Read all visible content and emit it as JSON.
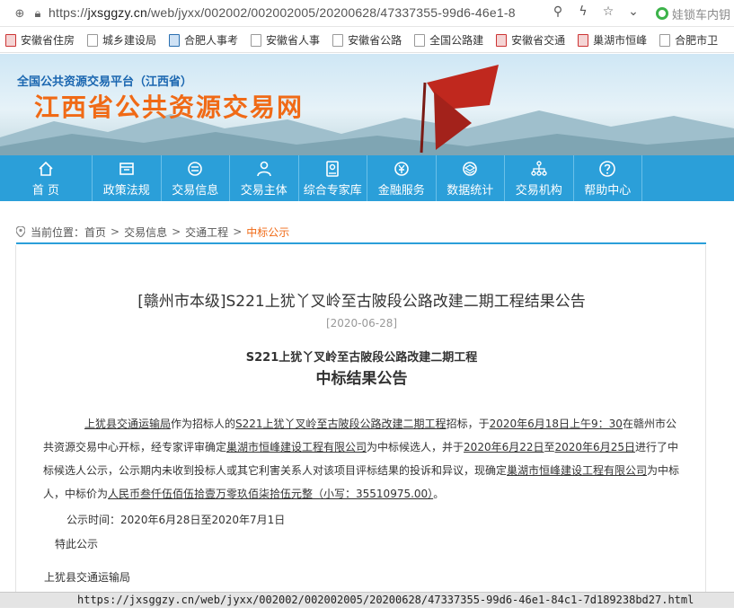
{
  "browser": {
    "url_prefix": "https://",
    "url_host": "jxsggzy.cn",
    "url_path": "/web/jyxx/002002/002002005/20200628/47337355-99d6-46e1-8",
    "search_text": "娃锁车内钥",
    "bookmarks": [
      {
        "label": "安徽省住房",
        "icon": "red-doc-icon"
      },
      {
        "label": "城乡建设局",
        "icon": "doc-icon"
      },
      {
        "label": "合肥人事考",
        "icon": "blue-doc-icon"
      },
      {
        "label": "安徽省人事",
        "icon": "doc-icon"
      },
      {
        "label": "安徽省公路",
        "icon": "doc-icon"
      },
      {
        "label": "全国公路建",
        "icon": "doc-icon"
      },
      {
        "label": "安徽省交通",
        "icon": "red-doc-icon"
      },
      {
        "label": "巢湖市恒峰",
        "icon": "red-doc-icon"
      },
      {
        "label": "合肥市卫",
        "icon": "doc-icon"
      }
    ]
  },
  "site": {
    "subtitle": "全国公共资源交易平台（江西省）",
    "title": "江西省公共资源交易网"
  },
  "nav": [
    {
      "label": "首 页",
      "icon": "home-icon"
    },
    {
      "label": "政策法规",
      "icon": "folder-icon"
    },
    {
      "label": "交易信息",
      "icon": "list-icon"
    },
    {
      "label": "交易主体",
      "icon": "user-icon"
    },
    {
      "label": "综合专家库",
      "icon": "badge-icon"
    },
    {
      "label": "金融服务",
      "icon": "coin-icon"
    },
    {
      "label": "数据统计",
      "icon": "layers-icon"
    },
    {
      "label": "交易机构",
      "icon": "org-icon"
    },
    {
      "label": "帮助中心",
      "icon": "question-icon"
    }
  ],
  "breadcrumb": {
    "prefix": "当前位置：",
    "items": [
      "首页",
      "交易信息",
      "交通工程"
    ],
    "current": "中标公示"
  },
  "article": {
    "title": "[赣州市本级]S221上犹丫叉岭至古陂段公路改建二期工程结果公告",
    "date": "[2020-06-28]",
    "heading1": "S221上犹丫叉岭至古陂段公路改建二期工程",
    "heading2": "中标结果公告",
    "p_owner": "上犹县交通运输局",
    "p_t1": "作为招标人的",
    "p_project": "S221上犹丫叉岭至古陂段公路改建二期工程",
    "p_t2": "招标，于",
    "p_opendate": "2020年6月18日上午9：30",
    "p_t3": "在赣州市公共资源交易中心开标，经专家评审确定",
    "p_candidate": "巢湖市恒峰建设工程有限公司",
    "p_t4": "为中标候选人，并于",
    "p_from": "2020年6月22日",
    "p_t5": "至",
    "p_to": "2020年6月25日",
    "p_t6": "进行了中标候选人公示，公示期内未收到投标人或其它利害关系人对该项目评标结果的投诉和异议，现确定",
    "p_winner": "巢湖市恒峰建设工程有限公司",
    "p_t7": "为中标人，中标价为",
    "p_price": "人民币叁仟伍佰伍拾壹万零玖佰柒拾伍元整（小写：35510975.00）",
    "p_t8": "。",
    "notice_period": "公示时间：2020年6月28日至2020年7月1日",
    "special": "特此公示",
    "signer": "上犹县交通运输局"
  },
  "status_url": "https://jxsggzy.cn/web/jyxx/002002/002002005/20200628/47337355-99d6-46e1-84c1-7d189238bd27.html"
}
